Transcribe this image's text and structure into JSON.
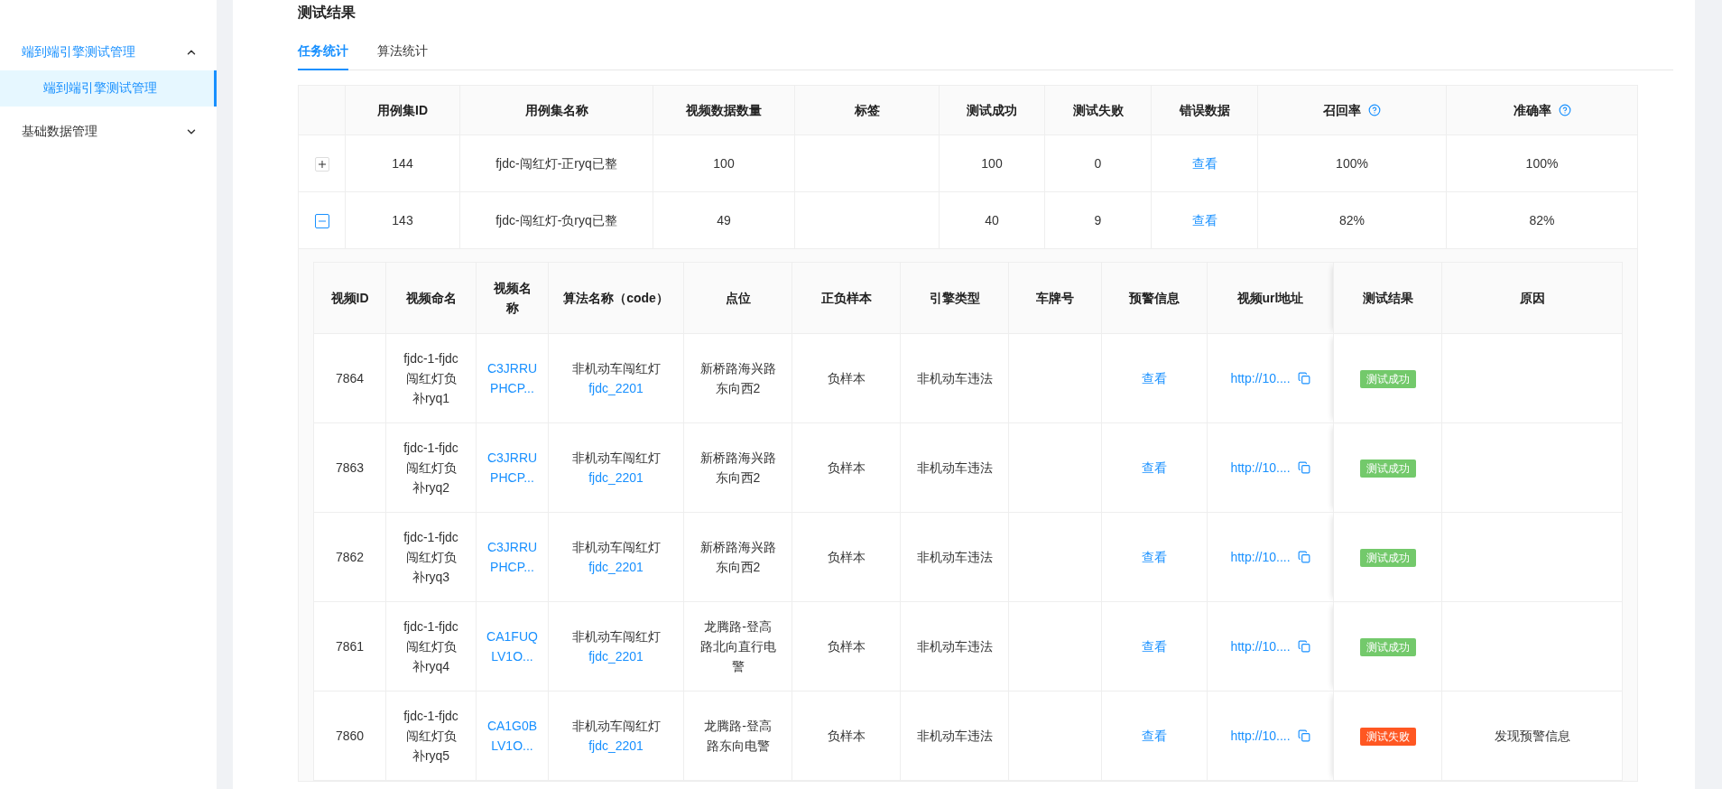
{
  "sidebar": {
    "items": [
      {
        "label": "端到端引擎测试管理",
        "expanded": true,
        "children": [
          {
            "label": "端到端引擎测试管理",
            "selected": true
          }
        ]
      },
      {
        "label": "基础数据管理",
        "expanded": false
      }
    ]
  },
  "section_title": "测试结果",
  "tabs": [
    {
      "label": "任务统计",
      "selected": true
    },
    {
      "label": "算法统计",
      "selected": false
    }
  ],
  "table": {
    "columns": [
      {
        "label": "用例集ID",
        "help": false
      },
      {
        "label": "用例集名称",
        "help": false
      },
      {
        "label": "视频数据数量",
        "help": false
      },
      {
        "label": "标签",
        "help": false
      },
      {
        "label": "测试成功",
        "help": false
      },
      {
        "label": "测试失败",
        "help": false
      },
      {
        "label": "错误数据",
        "help": false
      },
      {
        "label": "召回率",
        "help": true
      },
      {
        "label": "准确率",
        "help": true
      }
    ],
    "rows": [
      {
        "expanded": false,
        "case_id": "144",
        "case_name": "fjdc-闯红灯-正ryq已整",
        "video_count": "100",
        "success": "100",
        "fail": "0",
        "error_link": "查看",
        "recall": "100%",
        "precision": "100%"
      },
      {
        "expanded": true,
        "case_id": "143",
        "case_name": "fjdc-闯红灯-负ryq已整",
        "video_count": "49",
        "success": "40",
        "fail": "9",
        "error_link": "查看",
        "recall": "82%",
        "precision": "82%",
        "detail": {
          "columns": [
            "视频ID",
            "视频命名",
            "视频名称",
            "算法名称（code）",
            "点位",
            "正负样本",
            "引擎类型",
            "车牌号",
            "预警信息",
            "视频url地址",
            "测试结果",
            "原因"
          ],
          "rows": [
            {
              "video_id": "7864",
              "video_title": "fjdc-1-fjdc闯红灯负补ryq1",
              "video_name": "C3JRRUPHCP...",
              "algorithm": "非机动车闯红灯",
              "algorithm_code": "fjdc_2201",
              "location": "新桥路海兴路东向西2",
              "sample": "负样本",
              "engine": "非机动车违法",
              "warning_link": "查看",
              "url": "http://10....",
              "result": {
                "text": "测试成功",
                "kind": "success"
              }
            },
            {
              "video_id": "7863",
              "video_title": "fjdc-1-fjdc闯红灯负补ryq2",
              "video_name": "C3JRRUPHCP...",
              "algorithm": "非机动车闯红灯",
              "algorithm_code": "fjdc_2201",
              "location": "新桥路海兴路东向西2",
              "sample": "负样本",
              "engine": "非机动车违法",
              "warning_link": "查看",
              "url": "http://10....",
              "result": {
                "text": "测试成功",
                "kind": "success"
              }
            },
            {
              "video_id": "7862",
              "video_title": "fjdc-1-fjdc闯红灯负补ryq3",
              "video_name": "C3JRRUPHCP...",
              "algorithm": "非机动车闯红灯",
              "algorithm_code": "fjdc_2201",
              "location": "新桥路海兴路东向西2",
              "sample": "负样本",
              "engine": "非机动车违法",
              "warning_link": "查看",
              "url": "http://10....",
              "result": {
                "text": "测试成功",
                "kind": "success"
              }
            },
            {
              "video_id": "7861",
              "video_title": "fjdc-1-fjdc闯红灯负补ryq4",
              "video_name": "CA1FUQLV1O...",
              "algorithm": "非机动车闯红灯",
              "algorithm_code": "fjdc_2201",
              "location": "龙腾路-登高路北向直行电警",
              "sample": "负样本",
              "engine": "非机动车违法",
              "warning_link": "查看",
              "url": "http://10....",
              "result": {
                "text": "测试成功",
                "kind": "success"
              }
            },
            {
              "video_id": "7860",
              "video_title": "fjdc-1-fjdc闯红灯负补ryq5",
              "video_name": "CA1G0BLV1O...",
              "algorithm": "非机动车闯红灯",
              "algorithm_code": "fjdc_2201",
              "location": "龙腾路-登高路东向电警",
              "sample": "负样本",
              "engine": "非机动车违法",
              "warning_link": "查看",
              "url": "http://10....",
              "result": {
                "text": "测试失败",
                "kind": "fail"
              },
              "reason": "发现预警信息"
            }
          ]
        }
      }
    ]
  }
}
